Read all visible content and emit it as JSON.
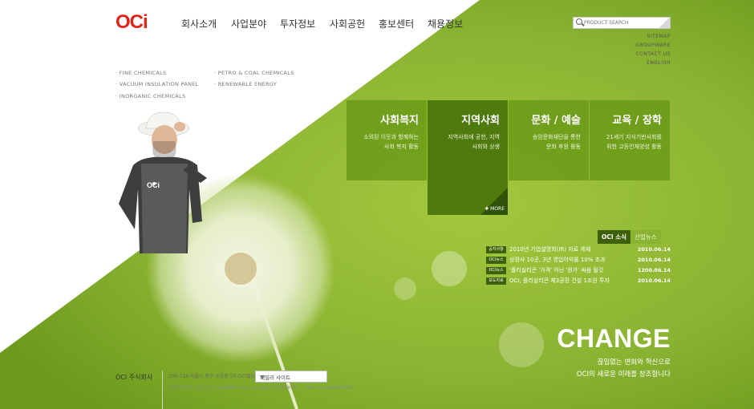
{
  "brand": {
    "logo": "OCi",
    "logo_color": "#e2231a"
  },
  "gnb": [
    "회사소개",
    "사업분야",
    "투자정보",
    "사회공헌",
    "홍보센터",
    "채용정보"
  ],
  "search": {
    "placeholder": "PRODUCT SEARCH",
    "icon": "search-icon"
  },
  "util_links": [
    "SITEMAP",
    "GROUPWARE",
    "CONTACT US",
    "ENGLISH"
  ],
  "business_links": [
    "FINE CHEMICALS",
    "VACUUM INSULATION PANEL",
    "INORGANIC CHEMICALS",
    "PETRO & COAL CHEMICALS",
    "RENEWABLE ENERGY"
  ],
  "tiles": [
    {
      "title": "사회복지",
      "desc": [
        "소외된 이웃과 함께하는",
        "사회 복지 활동"
      ]
    },
    {
      "title": "지역사회",
      "desc": [
        "지역사회에 공헌, 지역",
        "사회와 상생"
      ],
      "more": "MORE"
    },
    {
      "title": "문화 / 예술",
      "desc": [
        "송암문화재단을 통한",
        "문화 후원 활동"
      ]
    },
    {
      "title": "교육 / 장학",
      "desc": [
        "21세기 지식기반사회를",
        "위한 고등인재양성 활동"
      ]
    }
  ],
  "news_tabs": [
    "OCI 소식",
    "산업뉴스"
  ],
  "news": [
    {
      "badge": "공지사항",
      "title": "2010년 기업설명회(IR) 자료 게재",
      "date": "2010.06.14"
    },
    {
      "badge": "OCI뉴스",
      "title": "상장사 10곳, 3년 영업이익률 10% 초과",
      "date": "2010.06.14"
    },
    {
      "badge": "OCI뉴스",
      "title": "'폴리실리콘 '가격' 아닌 '원가' 싸움 될것",
      "date": "1200.06.14"
    },
    {
      "badge": "보도자료",
      "title": "OCI, 폴리실리콘 제3공장 건설 1조원 투자",
      "date": "2010.06.14"
    }
  ],
  "hero": {
    "headline": "CHANGE",
    "slogan": [
      "끊임없는 변화와 혁신으로",
      "OCI의 새로운 미래를 창조합니다"
    ]
  },
  "footer": {
    "company": "OCI 주식회사",
    "address": "100-718 서울시 중구 소공동 50 OCI빌딩",
    "family_site": "패밀리 사이트",
    "copyright": "COPYRIGHT 2010 OCI COMPANY LTD. ALL RIGHT RESERVED.",
    "webmaster": "MAIL TO WEBMASTER"
  },
  "colors": {
    "accent_green": "#8ab332",
    "dark_green": "#3c5f07",
    "tile_green": "#6a9a1a"
  }
}
